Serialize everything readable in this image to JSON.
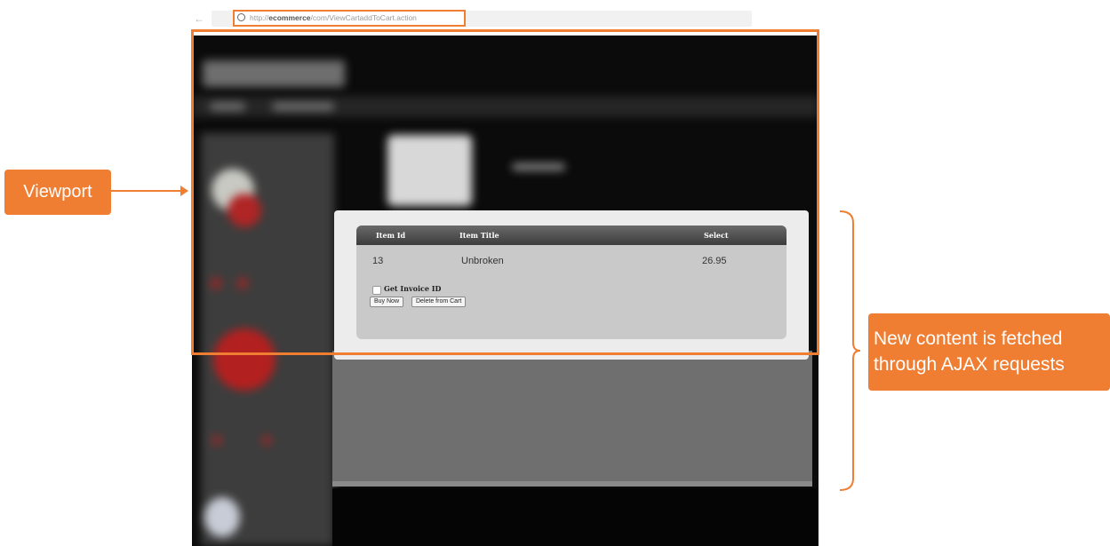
{
  "browser": {
    "back_glyph": "←",
    "reload_glyph": "C",
    "url_prefix": "http://",
    "url_host": "ecommerce",
    "url_path": "/com/ViewCartaddToCart.action"
  },
  "cart": {
    "columns": [
      "Item Id",
      "Item Title",
      "Select"
    ],
    "row": {
      "id": "13",
      "title": "Unbroken",
      "price": "26.95"
    },
    "checkbox_label": "Get Invoice ID",
    "buy_button": "Buy Now",
    "delete_button": "Delete from Cart"
  },
  "annotations": {
    "viewport_label": "Viewport",
    "ajax_label": [
      "New content is fetched",
      "through AJAX requests"
    ]
  },
  "colors": {
    "accent": "#ef7d32"
  }
}
